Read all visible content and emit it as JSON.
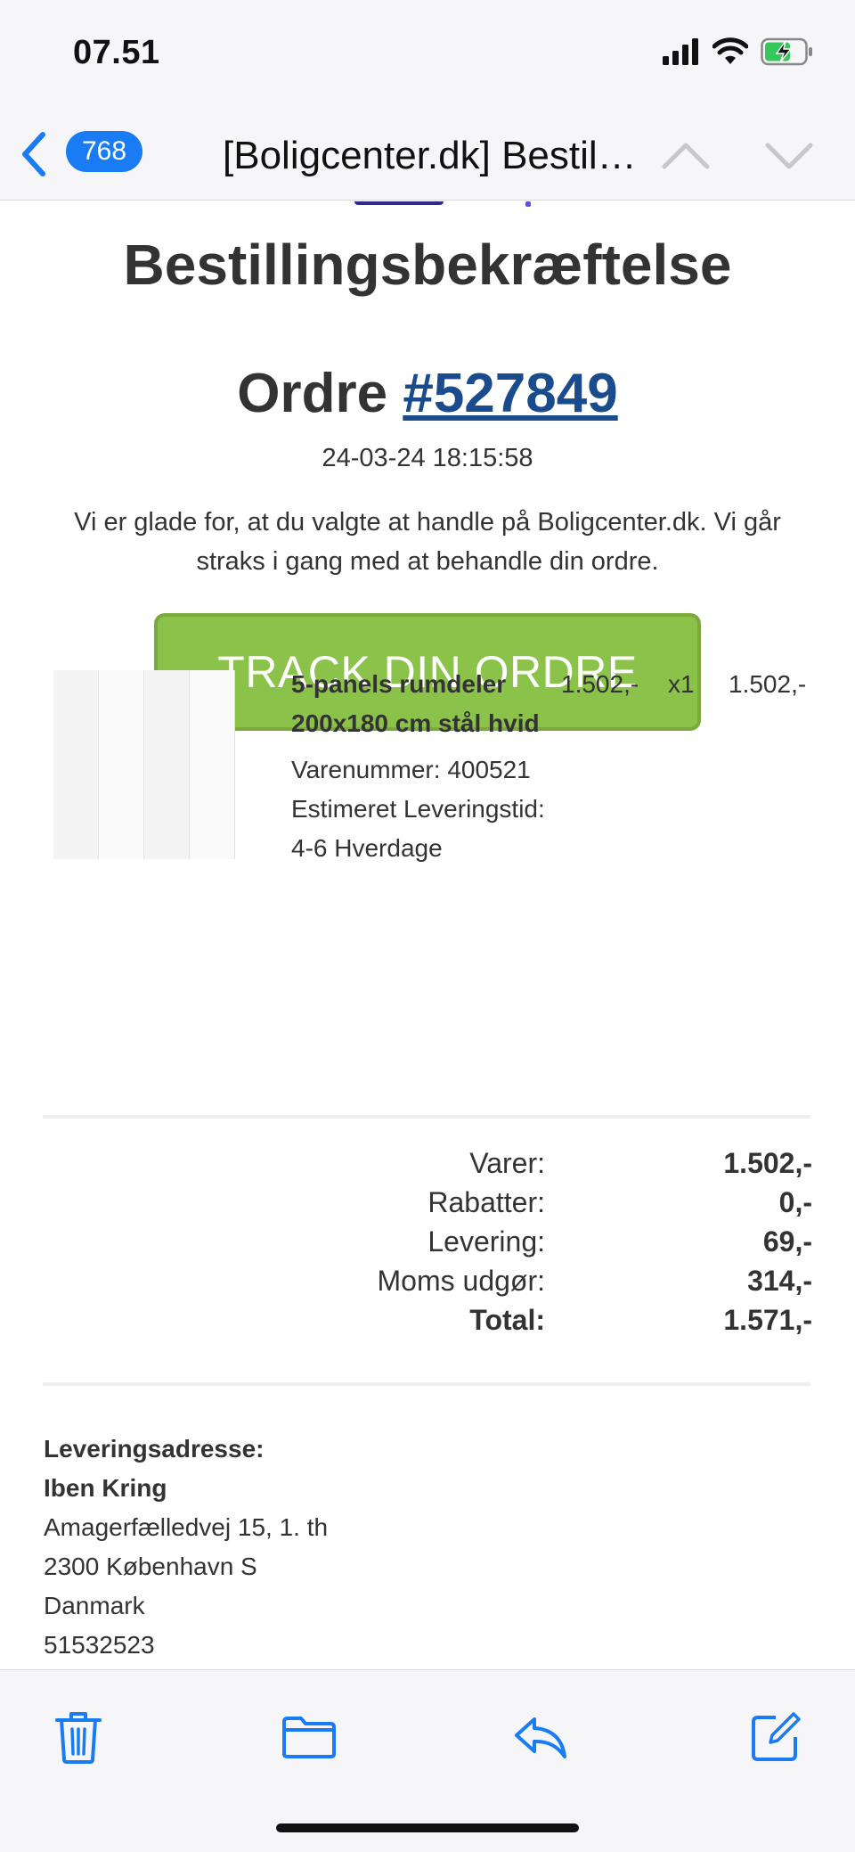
{
  "status_bar": {
    "time": "07.51"
  },
  "nav": {
    "badge_count": "768",
    "title": "[Boligcenter.dk] Bestillingsbekræftelse"
  },
  "email": {
    "heading": "Bestillingsbekræftelse",
    "order_prefix": "Ordre",
    "order_number": "#527849",
    "order_date": "24-03-24 18:15:58",
    "intro": "Vi er glade for, at du valgte at handle på Boligcenter.dk. Vi går straks i gang med at behandle din ordre.",
    "track_button": "TRACK DIN ORDRE",
    "product": {
      "name": "5-panels rumdeler 200x180 cm stål hvid",
      "unit_price": "1.502,-",
      "quantity": "x1",
      "line_total": "1.502,-",
      "sku": "Varenummer: 400521",
      "delivery_label": "Estimeret Leveringstid:",
      "delivery_time": "4-6 Hverdage"
    },
    "totals": [
      {
        "label": "Varer:",
        "value": "1.502,-"
      },
      {
        "label": "Rabatter:",
        "value": "0,-"
      },
      {
        "label": "Levering:",
        "value": "69,-"
      },
      {
        "label": "Moms udgør:",
        "value": "314,-"
      },
      {
        "label": "Total:",
        "value": "1.571,-"
      }
    ],
    "address": {
      "label": "Leveringsadresse:",
      "name": "Iben Kring",
      "street": "Amagerfælledvej 15, 1. th",
      "city": "2300 København S",
      "country": "Danmark",
      "phone": "51532523"
    }
  },
  "colors": {
    "accent": "#1a7cf5",
    "track_button": "#8bc34a",
    "order_link": "#1a4b8c"
  },
  "toolbar": {
    "icons": [
      "trash-icon",
      "folder-icon",
      "reply-icon",
      "compose-icon"
    ]
  }
}
